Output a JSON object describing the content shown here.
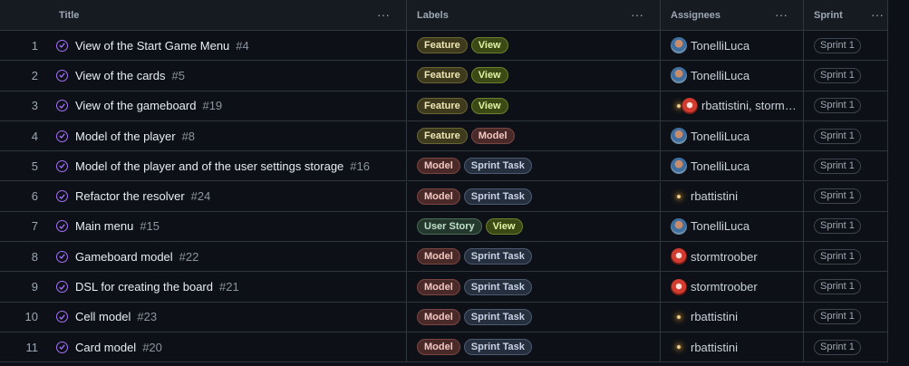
{
  "columns": {
    "title": "Title",
    "labels": "Labels",
    "assignees": "Assignees",
    "sprint": "Sprint",
    "menu_glyph": "···"
  },
  "rows": [
    {
      "index": "1",
      "title": "View of the Start Game Menu",
      "number": "#4",
      "labels": [
        {
          "text": "Feature",
          "kind": "feature"
        },
        {
          "text": "View",
          "kind": "view"
        }
      ],
      "assignees": "TonelliLuca",
      "avatar": "luca",
      "sprint": "Sprint 1"
    },
    {
      "index": "2",
      "title": "View of the cards",
      "number": "#5",
      "labels": [
        {
          "text": "Feature",
          "kind": "feature"
        },
        {
          "text": "View",
          "kind": "view"
        }
      ],
      "assignees": "TonelliLuca",
      "avatar": "luca",
      "sprint": "Sprint 1"
    },
    {
      "index": "3",
      "title": "View of the gameboard",
      "number": "#19",
      "labels": [
        {
          "text": "Feature",
          "kind": "feature"
        },
        {
          "text": "View",
          "kind": "view"
        }
      ],
      "assignees": "rbattistini, storm…",
      "avatar": "pair",
      "sprint": "Sprint 1"
    },
    {
      "index": "4",
      "title": "Model of the player",
      "number": "#8",
      "labels": [
        {
          "text": "Feature",
          "kind": "feature"
        },
        {
          "text": "Model",
          "kind": "model"
        }
      ],
      "assignees": "TonelliLuca",
      "avatar": "luca",
      "sprint": "Sprint 1"
    },
    {
      "index": "5",
      "title": "Model of the player and of the user settings storage",
      "number": "#16",
      "labels": [
        {
          "text": "Model",
          "kind": "model"
        },
        {
          "text": "Sprint Task",
          "kind": "sprint"
        }
      ],
      "assignees": "TonelliLuca",
      "avatar": "luca",
      "sprint": "Sprint 1"
    },
    {
      "index": "6",
      "title": "Refactor the resolver",
      "number": "#24",
      "labels": [
        {
          "text": "Model",
          "kind": "model"
        },
        {
          "text": "Sprint Task",
          "kind": "sprint"
        }
      ],
      "assignees": "rbattistini",
      "avatar": "rb",
      "sprint": "Sprint 1"
    },
    {
      "index": "7",
      "title": "Main menu",
      "number": "#15",
      "labels": [
        {
          "text": "User Story",
          "kind": "story"
        },
        {
          "text": "View",
          "kind": "view"
        }
      ],
      "assignees": "TonelliLuca",
      "avatar": "luca",
      "sprint": "Sprint 1"
    },
    {
      "index": "8",
      "title": "Gameboard model",
      "number": "#22",
      "labels": [
        {
          "text": "Model",
          "kind": "model"
        },
        {
          "text": "Sprint Task",
          "kind": "sprint"
        }
      ],
      "assignees": "stormtroober",
      "avatar": "storm",
      "sprint": "Sprint 1"
    },
    {
      "index": "9",
      "title": "DSL for creating the board",
      "number": "#21",
      "labels": [
        {
          "text": "Model",
          "kind": "model"
        },
        {
          "text": "Sprint Task",
          "kind": "sprint"
        }
      ],
      "assignees": "stormtroober",
      "avatar": "storm",
      "sprint": "Sprint 1"
    },
    {
      "index": "10",
      "title": "Cell model",
      "number": "#23",
      "labels": [
        {
          "text": "Model",
          "kind": "model"
        },
        {
          "text": "Sprint Task",
          "kind": "sprint"
        }
      ],
      "assignees": "rbattistini",
      "avatar": "rb",
      "sprint": "Sprint 1"
    },
    {
      "index": "11",
      "title": "Card model",
      "number": "#20",
      "labels": [
        {
          "text": "Model",
          "kind": "model"
        },
        {
          "text": "Sprint Task",
          "kind": "sprint"
        }
      ],
      "assignees": "rbattistini",
      "avatar": "rb",
      "sprint": "Sprint 1"
    }
  ],
  "colors": {
    "background": "#0d1117",
    "header_background": "#161b22",
    "border": "#30363d",
    "status_icon": "#a371f7"
  },
  "icons": {
    "status": "closed-issue-check-icon",
    "column_menu": "kebab-menu-icon"
  }
}
